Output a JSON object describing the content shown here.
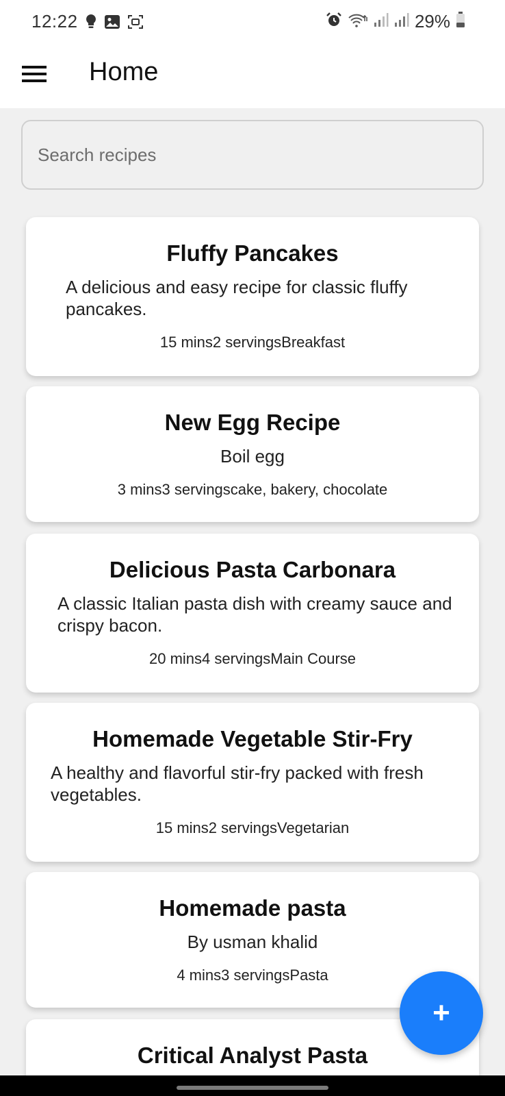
{
  "status": {
    "time": "12:22",
    "battery": "29%",
    "icons_left": [
      "lightbulb-icon",
      "image-icon",
      "screen-record-icon"
    ],
    "icons_right": [
      "alarm-icon",
      "wifi-icon",
      "signal-icon",
      "signal-icon",
      "battery-icon"
    ]
  },
  "app_bar": {
    "title": "Home"
  },
  "search": {
    "placeholder": "Search recipes",
    "value": ""
  },
  "recipes": [
    {
      "title": "Fluffy Pancakes",
      "description": "A delicious and easy recipe for classic fluffy pancakes.",
      "meta": "15 mins2 servingsBreakfast"
    },
    {
      "title": "New Egg Recipe",
      "description": "Boil egg",
      "meta": "3 mins3 servingscake, bakery, chocolate"
    },
    {
      "title": "Delicious Pasta Carbonara",
      "description": "A classic Italian pasta dish with creamy sauce and crispy bacon.",
      "meta": "20 mins4 servingsMain Course"
    },
    {
      "title": "Homemade Vegetable Stir-Fry",
      "description": "A healthy and flavorful stir-fry packed with fresh vegetables.",
      "meta": "15 mins2 servingsVegetarian"
    },
    {
      "title": "Homemade pasta",
      "description": "By usman khalid",
      "meta": "4 mins3 servingsPasta"
    },
    {
      "title": "Critical Analyst Pasta"
    }
  ],
  "fab": {
    "label": "+"
  },
  "colors": {
    "accent": "#1a7efb",
    "background": "#f0f0f0",
    "card": "#ffffff"
  }
}
